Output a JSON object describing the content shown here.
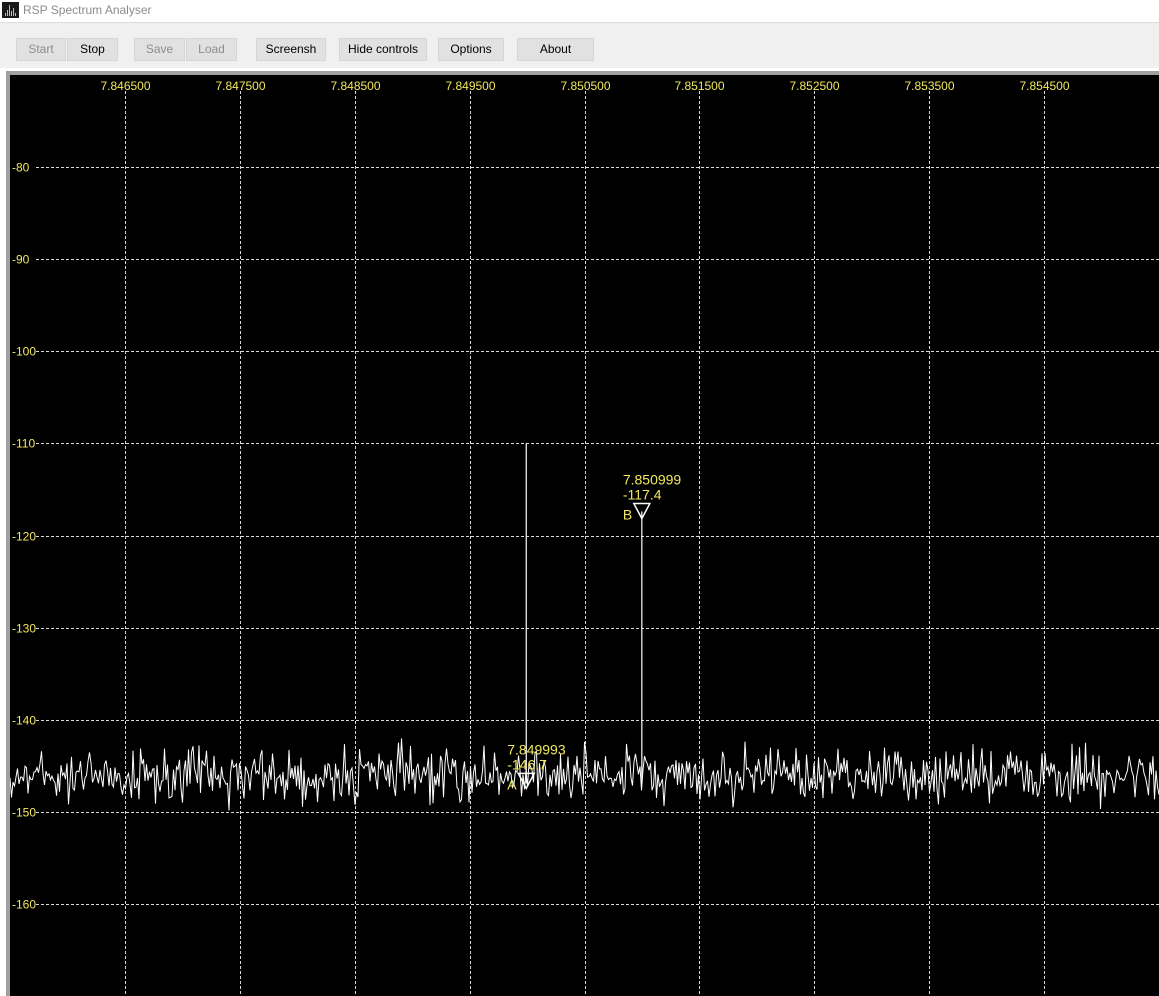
{
  "window": {
    "title": "RSP Spectrum Analyser",
    "icon": "spectrum-app-icon"
  },
  "toolbar": {
    "start_label": "Start",
    "stop_label": "Stop",
    "save_label": "Save",
    "load_label": "Load",
    "screenshot_label": "Screensh",
    "hide_controls_label": "Hide controls",
    "options_label": "Options",
    "about_label": "About"
  },
  "colors": {
    "background": "#000000",
    "grid": "#ffffff",
    "labels": "#f2e85c",
    "trace": "#ffffff"
  },
  "chart_data": {
    "type": "line",
    "x_ticks": [
      "7.846500",
      "7.847500",
      "7.848500",
      "7.849500",
      "7.850500",
      "7.851500",
      "7.852500",
      "7.853500",
      "7.854500"
    ],
    "y_ticks": [
      "-80",
      "-90",
      "-100",
      "-110",
      "-120",
      "-130",
      "-140",
      "-150",
      "-160"
    ],
    "x_range": [
      7.8455,
      7.8555
    ],
    "y_range": [
      -70,
      -170
    ],
    "grid": true,
    "noise_floor": -148,
    "peaks": [
      {
        "x": 7.849993,
        "y": -110
      },
      {
        "x": 7.850999,
        "y": -117.4
      }
    ],
    "markers": [
      {
        "id": "A",
        "freq": "7.849993",
        "level": "-146.7",
        "x": 7.849993,
        "y": -146.7
      },
      {
        "id": "B",
        "freq": "7.850999",
        "level": "-117.4",
        "x": 7.850999,
        "y": -117.4
      }
    ]
  }
}
